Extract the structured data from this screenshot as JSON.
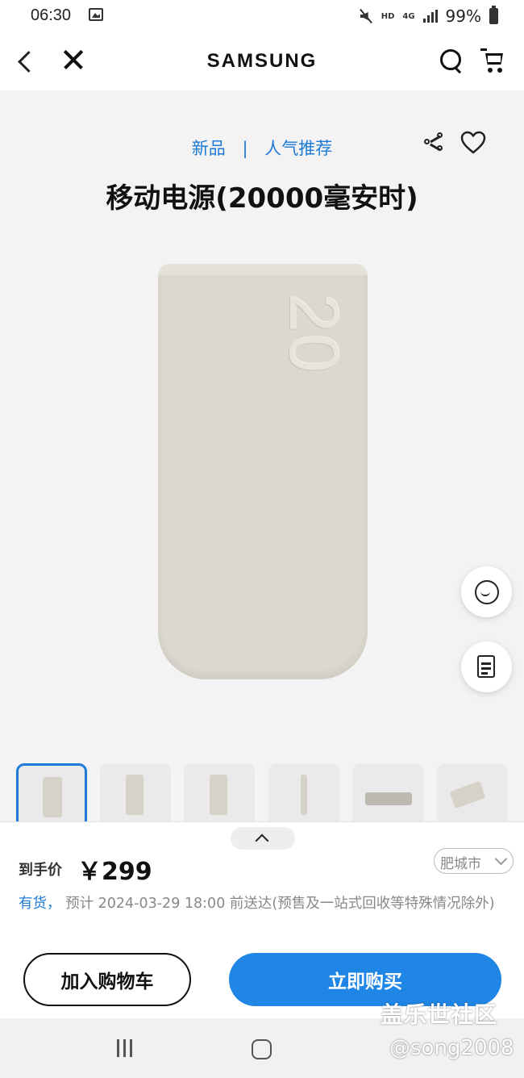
{
  "status_bar": {
    "time": "06:30",
    "network_hd": "HD",
    "network_type": "4G",
    "battery": "99%"
  },
  "header": {
    "brand": "SAMSUNG"
  },
  "product": {
    "tags": [
      "新品",
      "人气推荐"
    ],
    "tag_separator": "|",
    "title": "移动电源(20000毫安时)",
    "image_mark": "20",
    "thumbnail_count": 6
  },
  "purchase": {
    "price_label": "到手价",
    "price": "￥299",
    "city": "肥城市",
    "stock_status": "有货，",
    "delivery_text": " 预计 2024-03-29 18:00 前送达(预售及一站式回收等特殊情况除外)",
    "add_to_cart": "加入购物车",
    "buy_now": "立即购买"
  },
  "watermark": {
    "text": "盖乐世社区",
    "user": "@song2008"
  },
  "colors": {
    "accent": "#1f86e6",
    "tag_blue": "#1d7ad6",
    "product_beige": "#dcd8cf"
  }
}
